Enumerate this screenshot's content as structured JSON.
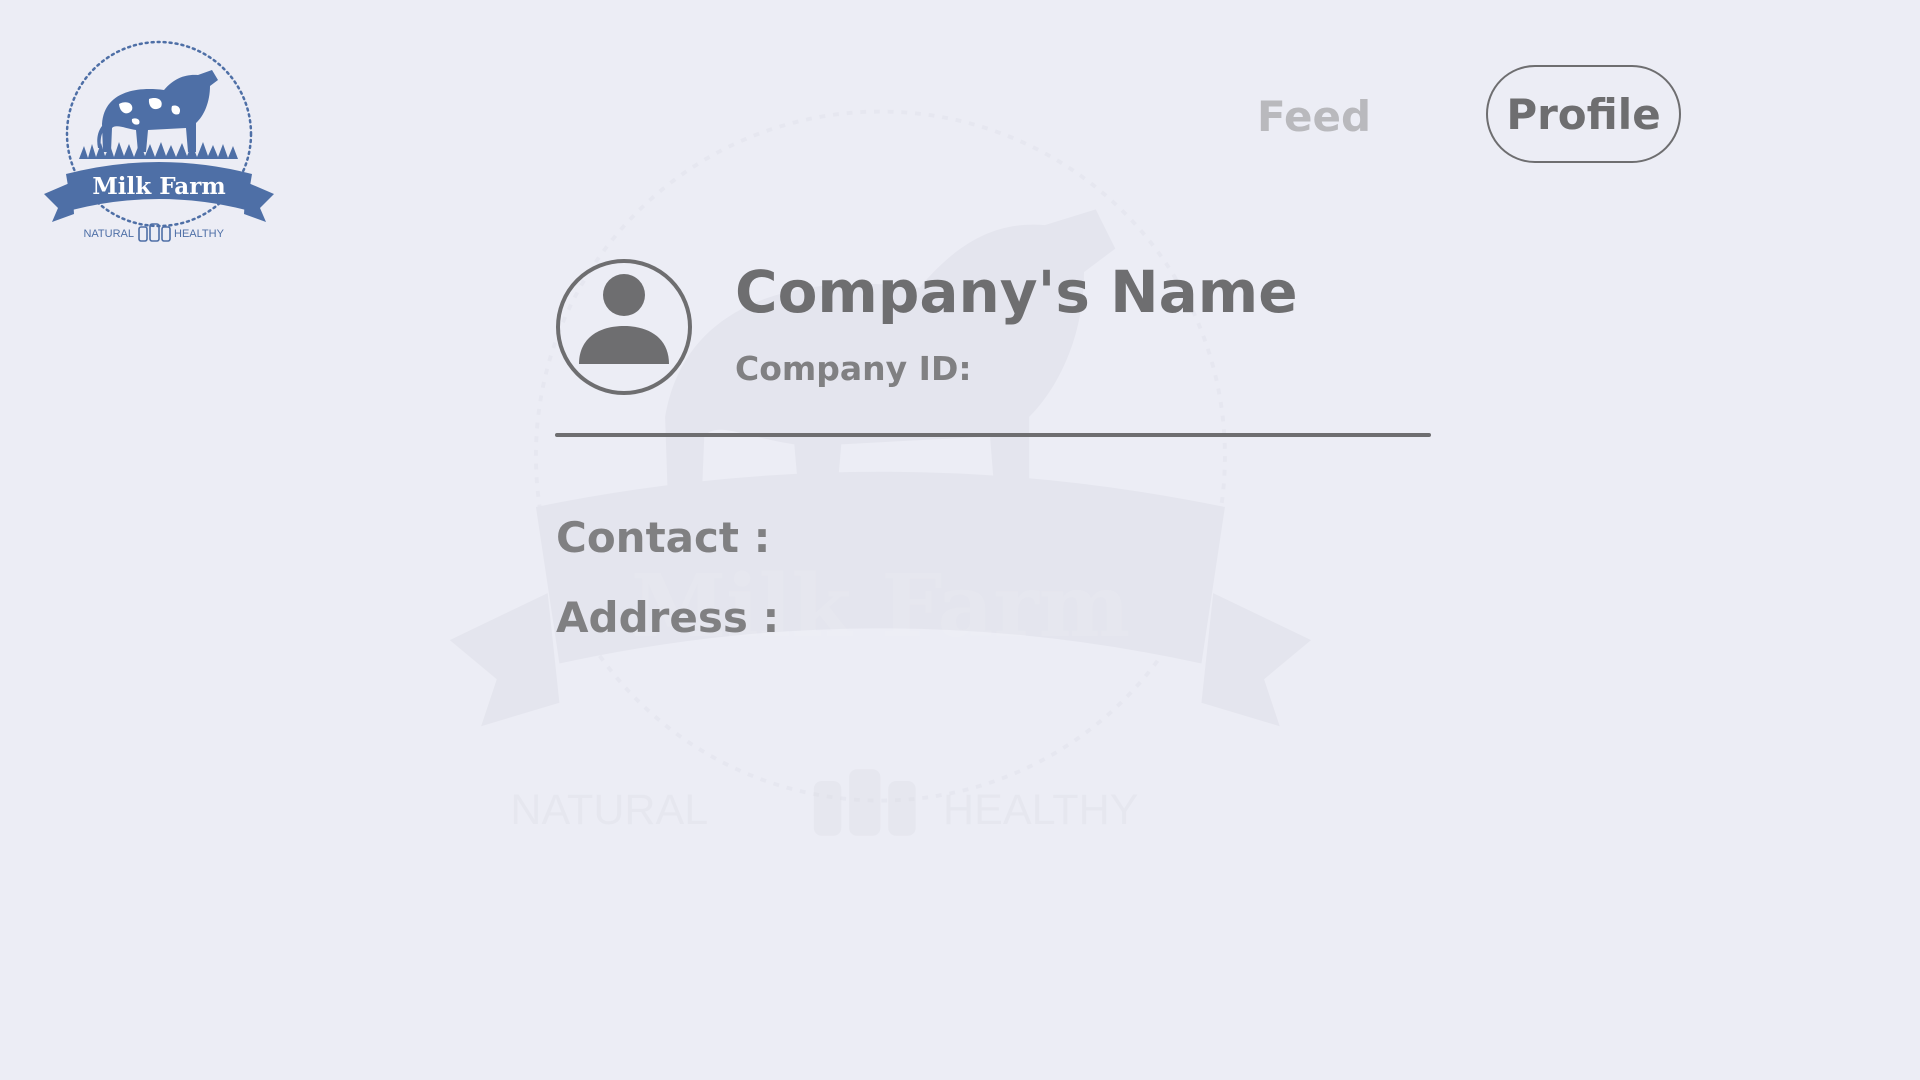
{
  "logo": {
    "brand_text": "Milk Farm",
    "tagline_left": "NATURAL",
    "tagline_right": "HEALTHY"
  },
  "nav": {
    "feed_label": "Feed",
    "profile_label": "Profile"
  },
  "profile": {
    "company_name": "Company's Name",
    "company_id_label": "Company ID:",
    "contact_label": "Contact :",
    "address_label": "Address :"
  },
  "colors": {
    "background": "#ecedf5",
    "brand_blue": "#4e6fa6",
    "text_dark": "#6e6e70",
    "text_muted": "#808082",
    "nav_inactive": "#b9b9bd"
  },
  "icons": {
    "avatar": "user-avatar-icon",
    "logo": "milk-farm-cow-logo"
  }
}
